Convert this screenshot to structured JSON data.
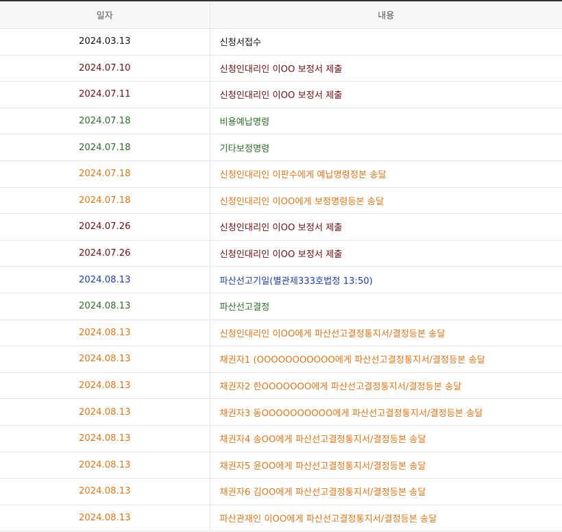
{
  "header": {
    "date_label": "일자",
    "content_label": "내용"
  },
  "colors": {
    "black": "#111111",
    "maroon": "#6b0f0f",
    "green": "#2f6b2a",
    "orange": "#d9771e",
    "blue": "#1f3f9c"
  },
  "rows": [
    {
      "date": "2024.03.13",
      "content": "신청서접수",
      "color": "black"
    },
    {
      "date": "2024.07.10",
      "content": "신청인대리인 이OO 보정서 제출",
      "color": "maroon"
    },
    {
      "date": "2024.07.11",
      "content": "신청인대리인 이OO 보정서 제출",
      "color": "maroon"
    },
    {
      "date": "2024.07.18",
      "content": "비용예납명령",
      "color": "green"
    },
    {
      "date": "2024.07.18",
      "content": "기타보정명령",
      "color": "green"
    },
    {
      "date": "2024.07.18",
      "content": "신청인대리인 이판수에게 예납명령정본 송달",
      "color": "orange"
    },
    {
      "date": "2024.07.18",
      "content": "신청인대리인 이OO에게 보정명령등본 송달",
      "color": "orange"
    },
    {
      "date": "2024.07.26",
      "content": "신청인대리인 이OO 보정서 제출",
      "color": "maroon"
    },
    {
      "date": "2024.07.26",
      "content": "신청인대리인 이OO 보정서 제출",
      "color": "maroon"
    },
    {
      "date": "2024.08.13",
      "content": "파산선고기일(별관제333호법정 13:50)",
      "color": "blue"
    },
    {
      "date": "2024.08.13",
      "content": "파산선고결정",
      "color": "green"
    },
    {
      "date": "2024.08.13",
      "content": "신청인대리인 이OO에게 파산선고결정통지서/결정등본 송달",
      "color": "orange"
    },
    {
      "date": "2024.08.13",
      "content": "채권자1 (OOOOOOOOOOO에게 파산선고결정통지서/결정등본 송달",
      "color": "orange"
    },
    {
      "date": "2024.08.13",
      "content": "채권자2 한OOOOOOO에게 파산선고결정통지서/결정등본 송달",
      "color": "orange"
    },
    {
      "date": "2024.08.13",
      "content": "채권자3 동OOOOOOOOOO에게 파산선고결정통지서/결정등본 송달",
      "color": "orange"
    },
    {
      "date": "2024.08.13",
      "content": "채권자4 송OO에게 파산선고결정통지서/결정등본 송달",
      "color": "orange"
    },
    {
      "date": "2024.08.13",
      "content": "채권자5 윤OO에게 파산선고결정통지서/결정등본 송달",
      "color": "orange"
    },
    {
      "date": "2024.08.13",
      "content": "채권자6 김OO에게 파산선고결정통지서/결정등본 송달",
      "color": "orange"
    },
    {
      "date": "2024.08.13",
      "content": "파산관재인 이OO에게 파산선고결정통지서/결정등본 송달",
      "color": "orange"
    }
  ]
}
